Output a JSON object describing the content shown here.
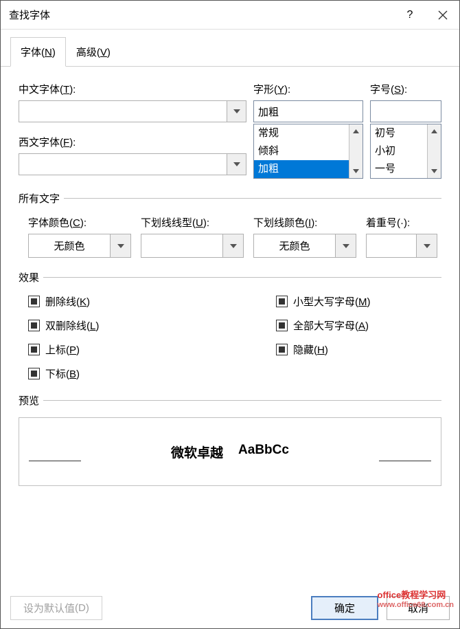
{
  "titlebar": {
    "title": "查找字体"
  },
  "tabs": {
    "font": "字体",
    "font_key": "N",
    "advanced": "高级",
    "advanced_key": "V"
  },
  "top": {
    "cn_font_label": "中文字体",
    "cn_font_key": "T",
    "cn_font_value": "",
    "west_font_label": "西文字体",
    "west_font_key": "F",
    "west_font_value": "",
    "style_label": "字形",
    "style_key": "Y",
    "style_value": "加粗",
    "size_label": "字号",
    "size_key": "S",
    "size_value": "",
    "style_options": [
      "常规",
      "倾斜",
      "加粗"
    ],
    "style_selected_index": 2,
    "size_options": [
      "初号",
      "小初",
      "一号"
    ]
  },
  "all_text": {
    "group_label": "所有文字",
    "font_color_label": "字体颜色",
    "font_color_key": "C",
    "font_color_value": "无颜色",
    "underline_style_label": "下划线线型",
    "underline_style_key": "U",
    "underline_style_value": "",
    "underline_color_label": "下划线颜色",
    "underline_color_key": "I",
    "underline_color_value": "无颜色",
    "emphasis_label": "着重号(·)",
    "emphasis_key": "",
    "emphasis_value": ""
  },
  "effects": {
    "group_label": "效果",
    "strike": "删除线",
    "strike_key": "K",
    "dstrike": "双删除线",
    "dstrike_key": "L",
    "super": "上标",
    "super_key": "P",
    "sub": "下标",
    "sub_key": "B",
    "smallcaps": "小型大写字母",
    "smallcaps_key": "M",
    "allcaps": "全部大写字母",
    "allcaps_key": "A",
    "hidden": "隐藏",
    "hidden_key": "H"
  },
  "preview": {
    "group_label": "预览",
    "sample_cn": "微软卓越",
    "sample_en": "AaBbCc"
  },
  "footer": {
    "default_label": "设为默认值",
    "default_key": "D",
    "ok": "确定",
    "cancel": "取消"
  },
  "watermark": {
    "line1": "office教程学习网",
    "line2": "www.office68.com.cn"
  }
}
